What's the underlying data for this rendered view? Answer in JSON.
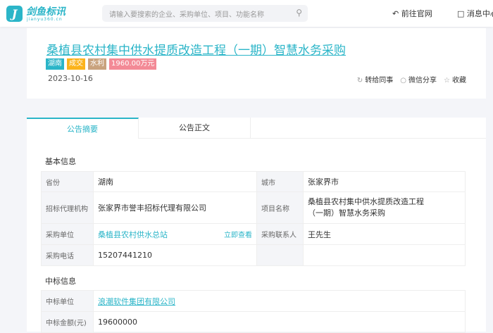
{
  "header": {
    "logo_text": "剑鱼标讯",
    "logo_sub": "jianyu360.cn",
    "search_placeholder": "请输入要搜索的企业、采购单位、项目、功能名称",
    "goto_site": "前往官网",
    "messages": "消息中心"
  },
  "notice": {
    "title": "桑植县农村集中供水提质改造工程（一期）智慧水务采购",
    "tags": [
      {
        "label": "湖南",
        "color": "#2bb5c8"
      },
      {
        "label": "成交",
        "color": "#fbb31b"
      },
      {
        "label": "水利",
        "color": "#c9a37e"
      },
      {
        "label": "1960.00万元",
        "color": "#f38a96"
      }
    ],
    "date": "2023-10-16",
    "actions": {
      "forward": "转给同事",
      "wechat": "微信分享",
      "favorite": "收藏"
    }
  },
  "tabs": [
    {
      "label": "公告摘要",
      "active": true
    },
    {
      "label": "公告正文",
      "active": false
    }
  ],
  "basic": {
    "title": "基本信息",
    "province_label": "省份",
    "province": "湖南",
    "city_label": "城市",
    "city": "张家界市",
    "agency_label": "招标代理机构",
    "agency": "张家界市誉丰招标代理有限公司",
    "project_label": "项目名称",
    "project": "桑植县农村集中供水提质改造工程（一期）智慧水务采购",
    "buyer_label": "采购单位",
    "buyer": "桑植县农村供水总站",
    "view_now": "立即查看",
    "contact_label": "采购联系人",
    "contact": "王先生",
    "phone_label": "采购电话",
    "phone": "15207441210"
  },
  "winner": {
    "title": "中标信息",
    "unit_label": "中标单位",
    "unit": "浪潮软件集团有限公司",
    "amount_label": "中标金额(元)",
    "amount": "19600000"
  }
}
